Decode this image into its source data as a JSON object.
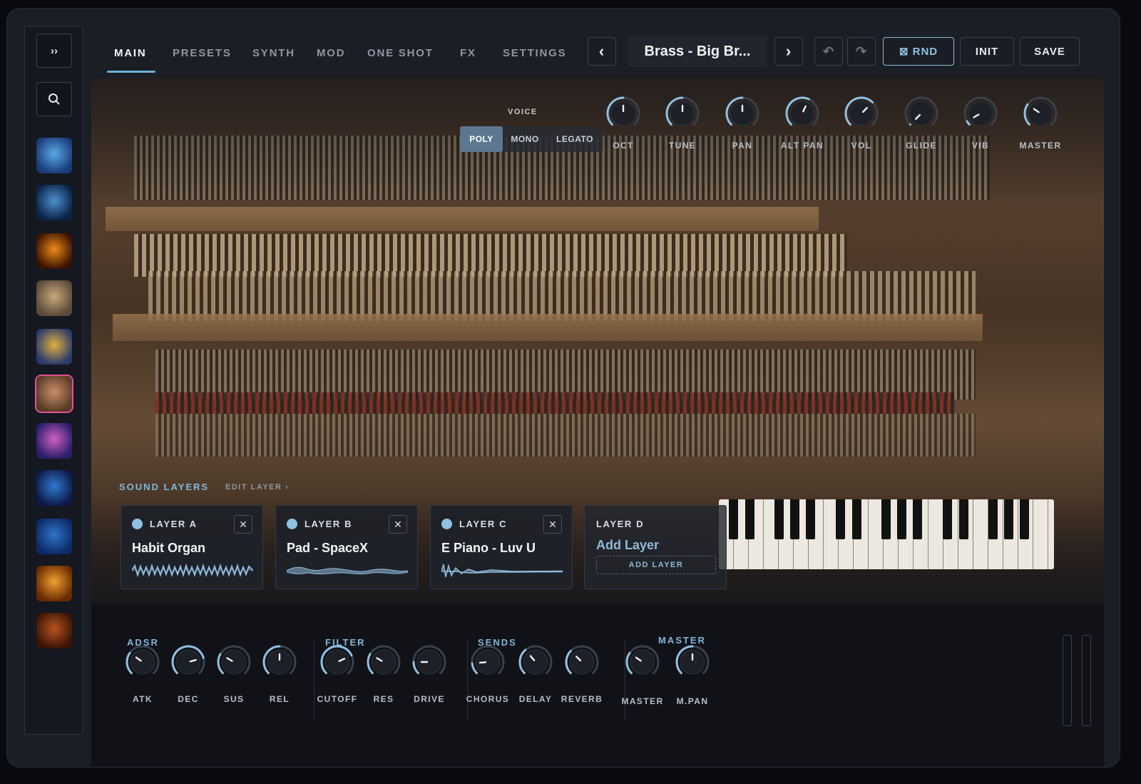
{
  "sidebar": {
    "expand_label": "››",
    "thumbs": [
      {
        "name": "preset-thumb-1",
        "text": "",
        "colors": [
          "#1a3b78",
          "#5aa8e6"
        ]
      },
      {
        "name": "preset-thumb-2",
        "text": "",
        "colors": [
          "#0a2245",
          "#4d8fd0"
        ]
      },
      {
        "name": "preset-thumb-3",
        "text": "",
        "colors": [
          "#3a1200",
          "#f08a1a"
        ]
      },
      {
        "name": "preset-thumb-4",
        "text": "",
        "colors": [
          "#5a4a3a",
          "#c8a878"
        ]
      },
      {
        "name": "preset-thumb-5",
        "text": "",
        "colors": [
          "#2a3a6a",
          "#e0b040"
        ]
      },
      {
        "name": "preset-thumb-6",
        "text": "",
        "colors": [
          "#5a3a26",
          "#c8906a"
        ]
      },
      {
        "name": "preset-thumb-7",
        "text": "",
        "colors": [
          "#2a1e6a",
          "#d060c0"
        ]
      },
      {
        "name": "preset-thumb-8",
        "text": "",
        "colors": [
          "#0e1a4a",
          "#2f7ad0"
        ]
      },
      {
        "name": "preset-thumb-9",
        "text": "",
        "colors": [
          "#0d2a66",
          "#2f74c8"
        ]
      },
      {
        "name": "preset-thumb-10",
        "text": "",
        "colors": [
          "#6a2a00",
          "#f0a030"
        ]
      },
      {
        "name": "preset-thumb-11",
        "text": "",
        "colors": [
          "#3a1406",
          "#b8541e"
        ]
      }
    ]
  },
  "tabs": [
    "MAIN",
    "PRESETS",
    "SYNTH",
    "MOD",
    "ONE SHOT",
    "FX",
    "SETTINGS"
  ],
  "preset": {
    "prev": "‹",
    "name": "Brass - Big Br...",
    "next": "›"
  },
  "toolbar": {
    "undo": "↶",
    "redo": "↷",
    "rnd": "⊠ RND",
    "init": "INIT",
    "save": "SAVE"
  },
  "voice": {
    "label": "VOICE",
    "options": [
      "POLY",
      "MONO",
      "LEGATO"
    ],
    "selected": "POLY"
  },
  "top_knobs": [
    {
      "label": "OCT",
      "angle": 0
    },
    {
      "label": "TUNE",
      "angle": 0
    },
    {
      "label": "PAN",
      "angle": 0
    },
    {
      "label": "ALT PAN",
      "angle": 25
    },
    {
      "label": "VOL",
      "angle": 45
    },
    {
      "label": "GLIDE",
      "angle": -135
    },
    {
      "label": "VIB",
      "angle": -120
    },
    {
      "label": "MASTER",
      "angle": -55
    }
  ],
  "sound_layers": {
    "title": "SOUND LAYERS",
    "edit": "EDIT LAYER ›",
    "layers": [
      {
        "label": "LAYER A",
        "preset": "Habit Organ",
        "close": "✕"
      },
      {
        "label": "LAYER B",
        "preset": "Pad - SpaceX",
        "close": "✕"
      },
      {
        "label": "LAYER C",
        "preset": "E Piano - Luv U",
        "close": "✕"
      }
    ],
    "empty": {
      "label": "LAYER D",
      "title": "Add Layer",
      "button": "ADD LAYER"
    }
  },
  "adsr": {
    "title": "ADSR",
    "knobs": [
      {
        "label": "ATK",
        "angle": -55
      },
      {
        "label": "DEC",
        "angle": 75
      },
      {
        "label": "SUS",
        "angle": -60
      },
      {
        "label": "REL",
        "angle": 0
      }
    ]
  },
  "filter": {
    "title": "FILTER",
    "knobs": [
      {
        "label": "CUTOFF",
        "angle": 65
      },
      {
        "label": "RES",
        "angle": -60
      },
      {
        "label": "DRIVE",
        "angle": -90
      }
    ]
  },
  "sends": {
    "title": "SENDS",
    "knobs": [
      {
        "label": "CHORUS",
        "angle": -95
      },
      {
        "label": "DELAY",
        "angle": -40
      },
      {
        "label": "REVERB",
        "angle": -45
      }
    ]
  },
  "master": {
    "title": "MASTER",
    "knobs": [
      {
        "label": "MASTER",
        "angle": -55
      },
      {
        "label": "M.PAN",
        "angle": 0
      }
    ]
  },
  "accent_color": "#6fb0d8"
}
